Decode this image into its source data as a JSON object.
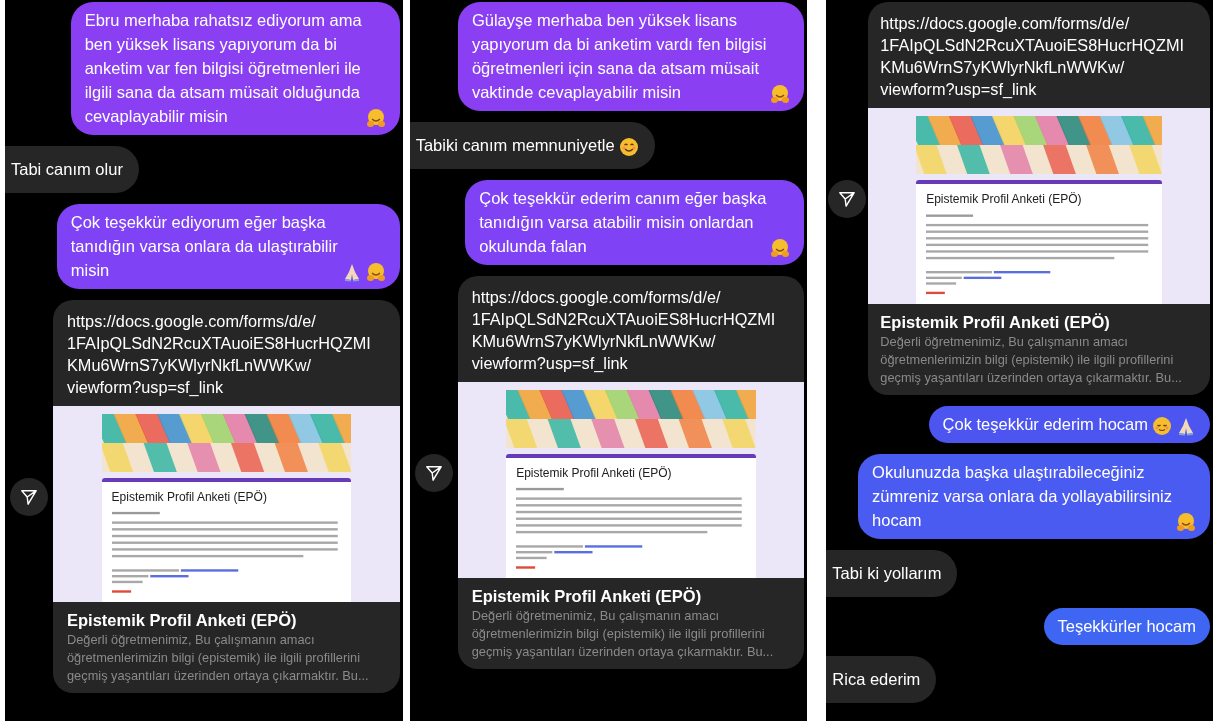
{
  "panels": [
    {
      "messages": [
        {
          "kind": "sent",
          "color": "#8a3ff2",
          "text": "Ebru merhaba rahatsız ediyorum ama\nben yüksek lisans yapıyorum da bi\nanketim var fen bilgisi öğretmenleri ile\nilgili sana da atsam müsait olduğunda\ncevaplayabilir misin",
          "emojis": [
            {
              "kind": "hug"
            }
          ]
        },
        {
          "kind": "received",
          "text": "Tabi canım olur"
        },
        {
          "kind": "sent",
          "color": "#7f42f4",
          "text": "Çok teşekkür ediyorum eğer başka\ntanıdığın varsa onlara da ulaştırabilir\nmisin",
          "emojis": [
            {
              "kind": "pray"
            },
            {
              "kind": "hug"
            }
          ]
        },
        {
          "kind": "link",
          "url": "https://docs.google.com/forms/d/e/\n1FAIpQLSdN2RcuXTAuoiES8HucrHQZMI\nKMu6WrnS7yKWlyrNkfLnWWKw/\nviewform?usp=sf_link",
          "form_title": "Epistemik Profil Anketi (EPÖ)",
          "title": "Epistemik Profil Anketi (EPÖ)",
          "description": "Değerli öğretmenimiz, Bu çalışmanın amacı\nöğretmenlerimizin bilgi (epistemik) ile ilgili profillerini\ngeçmiş yaşantıları üzerinden ortaya çıkarmaktır. Bu..."
        }
      ]
    },
    {
      "messages": [
        {
          "kind": "sent",
          "color": "#8a3ff2",
          "text": "Gülayşe merhaba ben yüksek lisans\nyapıyorum da bi anketim vardı fen bilgisi\nöğretmenleri için sana da atsam müsait\nvaktinde cevaplayabilir misin",
          "emojis": [
            {
              "kind": "hug"
            }
          ]
        },
        {
          "kind": "received",
          "text": "Tabiki canım memnuniyetle",
          "emojis": [
            {
              "kind": "smile"
            }
          ]
        },
        {
          "kind": "sent",
          "color": "#7f42f4",
          "text": "Çok teşekkür ederim canım eğer başka\ntanıdığın varsa atabilir misin onlardan\nokulunda falan",
          "emojis": [
            {
              "kind": "hug"
            }
          ]
        },
        {
          "kind": "link",
          "url": "https://docs.google.com/forms/d/e/\n1FAIpQLSdN2RcuXTAuoiES8HucrHQZMI\nKMu6WrnS7yKWlyrNkfLnWWKw/\nviewform?usp=sf_link",
          "form_title": "Epistemik Profil Anketi (EPÖ)",
          "title": "Epistemik Profil Anketi (EPÖ)",
          "description": "Değerli öğretmenimiz, Bu çalışmanın amacı\nöğretmenlerimizin bilgi (epistemik) ile ilgili profillerini\ngeçmiş yaşantıları üzerinden ortaya çıkarmaktır. Bu..."
        }
      ]
    },
    {
      "messages": [
        {
          "kind": "link",
          "url": "https://docs.google.com/forms/d/e/\n1FAIpQLSdN2RcuXTAuoiES8HucrHQZMI\nKMu6WrnS7yKWlyrNkfLnWWKw/\nviewform?usp=sf_link",
          "form_title": "Epistemik Profil Anketi (EPÖ)",
          "title": "Epistemik Profil Anketi (EPÖ)",
          "description": "Değerli öğretmenimiz, Bu çalışmanın amacı\nöğretmenlerimizin bilgi (epistemik) ile ilgili profillerini\ngeçmiş yaşantıları üzerinden ortaya çıkarmaktır. Bu..."
        },
        {
          "kind": "sent",
          "color": "#4c55f0",
          "text": "Çok teşekkür ederim hocam",
          "emojis": [
            {
              "kind": "relieved"
            },
            {
              "kind": "pray"
            }
          ]
        },
        {
          "kind": "sent",
          "color": "#4a5bf1",
          "text": "Okulunuzda başka ulaştırabileceğiniz\nzümreniz varsa onlara da yollayabilirsiniz\nhocam",
          "emojis": [
            {
              "kind": "hug"
            }
          ]
        },
        {
          "kind": "received",
          "text": "Tabi ki yollarım"
        },
        {
          "kind": "sent",
          "color": "#3f66f2",
          "text": "Teşekkürler hocam"
        },
        {
          "kind": "received",
          "text": "Rica ederim"
        }
      ]
    }
  ]
}
